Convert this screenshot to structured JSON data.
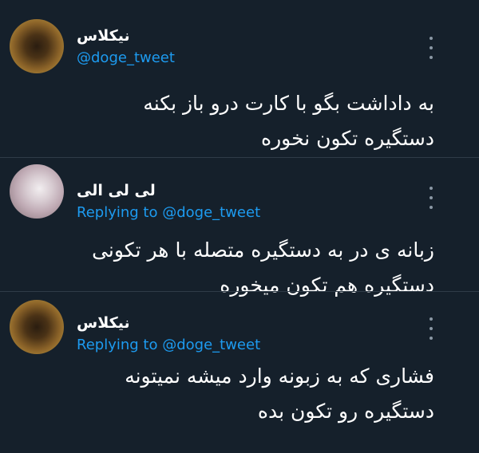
{
  "tweets": [
    {
      "author": "نیکلاس",
      "handle": "@doge_tweet",
      "replying_prefix": "",
      "replying_handle": "",
      "lines": [
        "به داداشت بگو با کارت درو باز بکنه",
        "دستگیره تکون نخوره"
      ]
    },
    {
      "author": "لی لی الی",
      "handle": "",
      "replying_prefix": "Replying to",
      "replying_handle": "@doge_tweet",
      "lines": [
        "زبانه ی در به دستگیره متصله با هر تکونی",
        "دستگیره هم تکون میخوره"
      ]
    },
    {
      "author": "نیکلاس",
      "handle": "",
      "replying_prefix": "Replying to",
      "replying_handle": "@doge_tweet",
      "lines": [
        "فشاری که به زبونه وارد میشه نمیتونه",
        "دستگیره رو تکون بده"
      ]
    }
  ],
  "icons": {
    "more": "more-vertical-icon"
  },
  "colors": {
    "background": "#15202b",
    "link": "#1d9bf0",
    "text": "#ffffff",
    "muted": "#8b98a5"
  }
}
